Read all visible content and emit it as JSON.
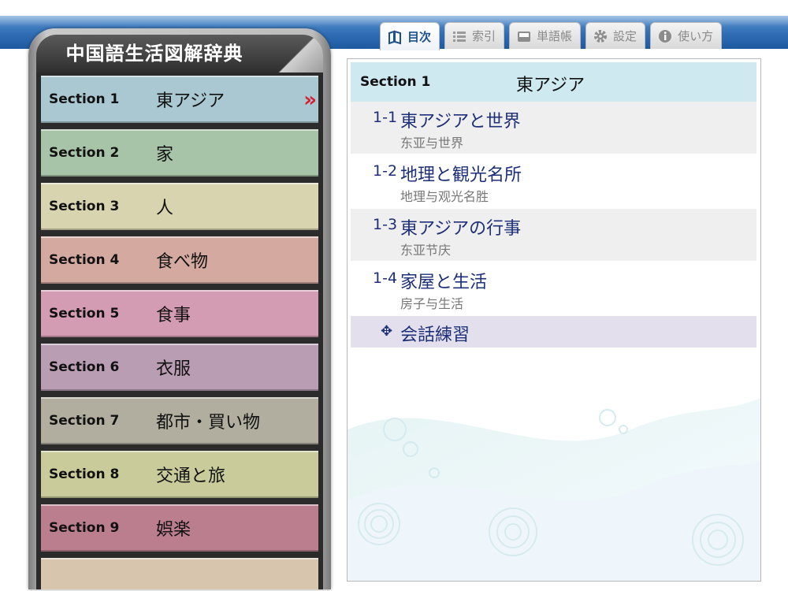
{
  "tabs": [
    {
      "label": "目次",
      "icon": "book-open-icon",
      "active": true
    },
    {
      "label": "索引",
      "icon": "list-icon",
      "active": false
    },
    {
      "label": "単語帳",
      "icon": "card-box-icon",
      "active": false
    },
    {
      "label": "設定",
      "icon": "gear-icon",
      "active": false
    },
    {
      "label": "使い方",
      "icon": "info-icon",
      "active": false
    }
  ],
  "sidebar": {
    "title": "中国語生活図解辞典",
    "sections": [
      {
        "label": "Section 1",
        "title": "東アジア",
        "color": "#a9c8d1",
        "selected": true
      },
      {
        "label": "Section 2",
        "title": "家",
        "color": "#a8c4a8"
      },
      {
        "label": "Section 3",
        "title": "人",
        "color": "#d8d4b0"
      },
      {
        "label": "Section 4",
        "title": "食べ物",
        "color": "#d3a9a0"
      },
      {
        "label": "Section 5",
        "title": "食事",
        "color": "#d49cb3"
      },
      {
        "label": "Section 6",
        "title": "衣服",
        "color": "#b99db3"
      },
      {
        "label": "Section 7",
        "title": "都市・買い物",
        "color": "#b1ae9f"
      },
      {
        "label": "Section 8",
        "title": "交通と旅",
        "color": "#c9cb9b"
      },
      {
        "label": "Section 9",
        "title": "娯楽",
        "color": "#bb7e8e"
      },
      {
        "label": "",
        "title": "",
        "color": "#d7c6ad"
      }
    ]
  },
  "content": {
    "header_label": "Section 1",
    "header_title": "東アジア",
    "entries": [
      {
        "num": "1-1",
        "ja": "東アジアと世界",
        "zh": "东亚与世界"
      },
      {
        "num": "1-2",
        "ja": "地理と観光名所",
        "zh": "地理与观光名胜"
      },
      {
        "num": "1-3",
        "ja": "東アジアの行事",
        "zh": "东亚节庆"
      },
      {
        "num": "1-4",
        "ja": "家屋と生活",
        "zh": "房子与生活"
      }
    ],
    "practice_icon": "✥",
    "practice_label": "会話練習"
  }
}
